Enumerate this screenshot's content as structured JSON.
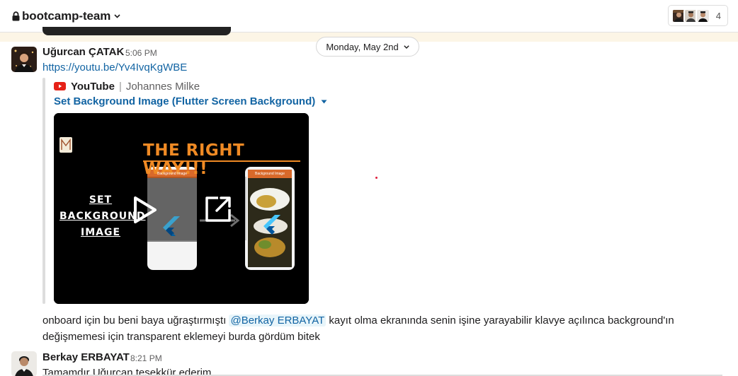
{
  "header": {
    "channel_name": "bootcamp-team",
    "member_count": "4"
  },
  "date_divider": {
    "label": "Monday, May 2nd"
  },
  "messages": [
    {
      "author": "Uğurcan ÇATAK",
      "time": "5:06 PM",
      "link": "https://youtu.be/Yv4IvqKgWBE",
      "attachment": {
        "service": "YouTube",
        "channel": "Johannes Milke",
        "title": "Set Background Image (Flutter Screen Background)",
        "thumbnail": {
          "headline": "THE RIGHT WAY!!!",
          "left_text_1": "SET",
          "left_text_2": "BACKGROUND",
          "left_text_3": "IMAGE",
          "phone_header_1": "Background Image",
          "phone_header_2": "Background Image"
        }
      },
      "text_before": "onboard için bu beni baya uğraştırmıştı ",
      "mention": "@Berkay ERBAYAT",
      "text_after": " kayıt olma ekranında senin işine yarayabilir klavye açılınca background'ın değişmemesi için transparent eklemeyi burda gördüm bitek"
    },
    {
      "author": "Berkay ERBAYAT",
      "time": "8:21 PM",
      "text": "Tamamdır Uğurcan teşekkür ederim"
    }
  ],
  "icons": [
    "lock-icon",
    "chevron-down-icon",
    "youtube-icon",
    "play-icon",
    "open-external-icon",
    "flutter-icon"
  ],
  "colors": {
    "link": "#1264a3",
    "band": "#fcf5e6",
    "thumb_accent": "#f08a24",
    "youtube_red": "#e62117"
  }
}
